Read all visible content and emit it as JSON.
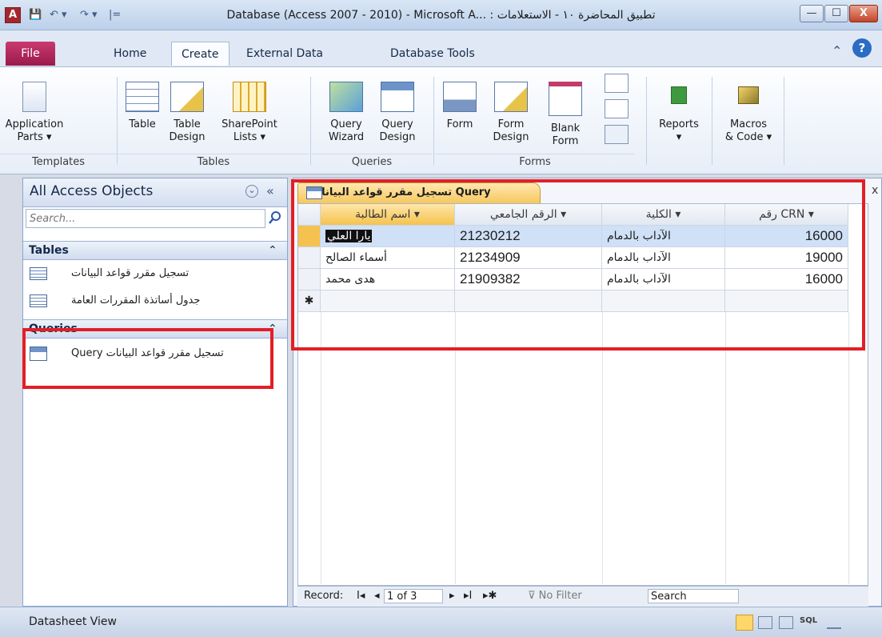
{
  "window": {
    "title": "Database (Access 2007 - 2010) - Microsoft A... : تطبيق المحاضرة ١٠ - الاستعلامات",
    "app_icon": "A",
    "controls": {
      "minimize": "—",
      "maximize": "☐",
      "close": "X"
    }
  },
  "qat": {
    "save": "💾",
    "undo": "↶ ▾",
    "redo": "↷ ▾",
    "customize": "|="
  },
  "tabs": [
    {
      "label": "File"
    },
    {
      "label": "Home"
    },
    {
      "label": "Create"
    },
    {
      "label": "External Data"
    },
    {
      "label": "Database Tools"
    }
  ],
  "ribbon_right": {
    "minimize": "⌃",
    "help": "?"
  },
  "ribbon": {
    "templates": {
      "application_parts": "Application\nParts ▾",
      "group": "Templates"
    },
    "tables": {
      "table": "Table",
      "table_design": "Table\nDesign",
      "sharepoint_lists": "SharePoint\nLists ▾",
      "group": "Tables"
    },
    "queries": {
      "query_wizard": "Query\nWizard",
      "query_design": "Query\nDesign",
      "group": "Queries"
    },
    "forms": {
      "form": "Form",
      "form_design": "Form\nDesign",
      "blank_form": "Blank\nForm",
      "group": "Forms"
    },
    "reports": {
      "label": "Reports",
      "arrow": "▾"
    },
    "macros": {
      "label": "Macros\n& Code ▾"
    }
  },
  "nav": {
    "title": "All Access Objects",
    "dropdown": "⌄",
    "collapse": "«",
    "search_placeholder": "Search...",
    "groups": {
      "tables": {
        "label": "Tables",
        "chevron": "⌃",
        "items": [
          "تسجيل مقرر قواعد البيانات",
          "جدول أساتذة المقررات العامة"
        ]
      },
      "queries": {
        "label": "Queries",
        "chevron": "⌃",
        "items": [
          "Query تسجيل مقرر قواعد البيانات"
        ]
      }
    }
  },
  "doc": {
    "tab_label": "Query تسجيل مقرر قواعد البيانات",
    "close": "x",
    "headers": [
      "رقم CRN",
      "الكلية",
      "الرقم الجامعي",
      "اسم الطالبة"
    ],
    "sort_arrow": "▾",
    "rows": [
      {
        "crn": "16000",
        "college": "الآداب بالدمام",
        "id": "21230212",
        "name": "يارا العلي"
      },
      {
        "crn": "19000",
        "college": "الآداب بالدمام",
        "id": "21234909",
        "name": "أسماء الصالح"
      },
      {
        "crn": "16000",
        "college": "الآداب بالدمام",
        "id": "21909382",
        "name": "هدى محمد"
      }
    ],
    "new_row": "✱"
  },
  "record_bar": {
    "label": "Record:",
    "first": "I◂",
    "prev": "◂",
    "position": "1 of 3",
    "next": "▸",
    "last": "▸I",
    "new": "▸✱",
    "filter": "No Filter",
    "search": "Search"
  },
  "status": {
    "text": "Datasheet View"
  }
}
